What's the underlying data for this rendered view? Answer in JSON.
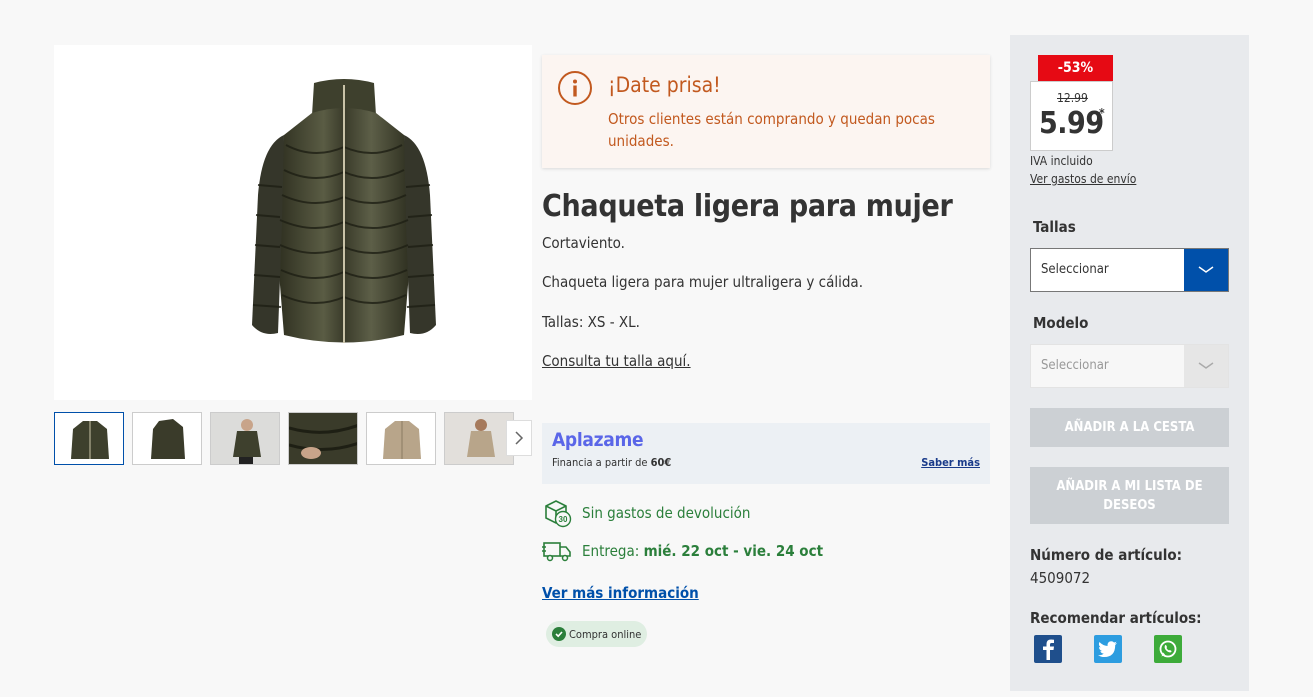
{
  "gallery": {
    "main_image_alt": "",
    "thumbnails": [
      "thumb-1",
      "thumb-2",
      "thumb-3",
      "thumb-4",
      "thumb-5",
      "thumb-6"
    ]
  },
  "hurry": {
    "title": "¡Date prisa!",
    "text": "Otros clientes están comprando y quedan pocas unidades."
  },
  "product": {
    "title": "Chaqueta ligera para mujer",
    "desc_1": "Cortaviento.",
    "desc_2": "Chaqueta ligera para mujer ultraligera y cálida.",
    "desc_3": "Tallas: XS - XL.",
    "size_link": "Consulta tu talla aquí."
  },
  "aplazame": {
    "logo": "Aplazame",
    "text_prefix": "Financia a partir de",
    "amount": "60€",
    "link": "Saber más"
  },
  "features": {
    "returns": "Sin gastos de devolución",
    "returns_days": "30",
    "delivery_label": "Entrega:",
    "delivery_dates": "mié. 22 oct - vie. 24 oct"
  },
  "more_info": "Ver más información",
  "online_badge": "Compra online",
  "price": {
    "discount": "-53%",
    "old": "12.99",
    "new": "5.99",
    "asterisk": "*",
    "vat": "IVA incluido",
    "shipping_link": "Ver gastos de envío"
  },
  "sizes": {
    "label": "Tallas",
    "value": "Seleccionar"
  },
  "model": {
    "label": "Modelo",
    "value": "Seleccionar"
  },
  "buttons": {
    "add_to_cart": "AÑADIR A LA CESTA",
    "add_to_wishlist": "AÑADIR A MI LISTA DE DESEOS"
  },
  "article": {
    "label": "Número de artículo:",
    "number": "4509072"
  },
  "recommend": {
    "label": "Recomendar artículos:"
  },
  "colors": {
    "brand_blue": "#0050aa",
    "hurry_orange": "#c2591f",
    "green": "#2b7f3b",
    "discount_red": "#e60a14",
    "facebook": "#1f4f8c",
    "twitter": "#2d9de0",
    "whatsapp": "#3dab3a"
  }
}
